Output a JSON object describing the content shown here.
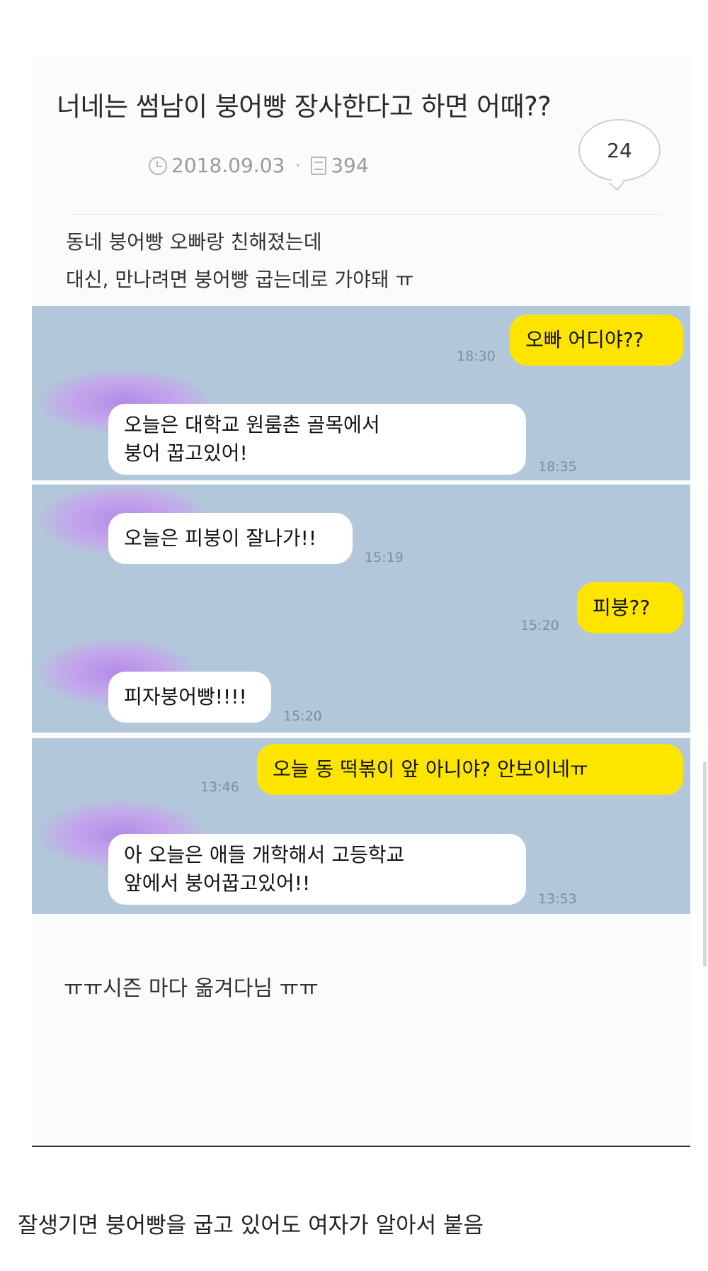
{
  "post": {
    "title": "너네는 썸남이 붕어빵 장사한다고 하면 어때??",
    "date": "2018.09.03",
    "views": "394",
    "comment_count": "24",
    "body_lines": [
      "동네 붕어빵 오빠랑 친해졌는데",
      "대신, 만나려면 붕어빵 굽는데로 가야돼 ㅠ"
    ],
    "footer": "ㅠㅠ시즌 마다 옮겨다님 ㅠㅠ"
  },
  "chats": [
    {
      "messages": [
        {
          "from": "me",
          "lines": [
            "오빠 어디야??"
          ],
          "time": "18:30"
        },
        {
          "from": "other",
          "lines": [
            "오늘은        대학교 원룸촌 골목에서",
            "붕어 꿉고있어!"
          ],
          "time": "18:35"
        }
      ]
    },
    {
      "messages": [
        {
          "from": "other",
          "lines": [
            "오늘은 피붕이 잘나가!!"
          ],
          "time": "15:19"
        },
        {
          "from": "me",
          "lines": [
            "피붕??"
          ],
          "time": "15:20"
        },
        {
          "from": "other",
          "lines": [
            "피자붕어빵!!!!"
          ],
          "time": "15:20"
        }
      ]
    },
    {
      "messages": [
        {
          "from": "me",
          "lines": [
            "오늘        동 떡볶이 앞 아니야? 안보이네ㅠ"
          ],
          "time": "13:46"
        },
        {
          "from": "other",
          "lines": [
            "아 오늘은 애들 개학해서        고등학교",
            "앞에서 붕어꿉고있어!!"
          ],
          "time": "13:53"
        }
      ]
    }
  ],
  "caption": "잘생기면 붕어빵을 굽고 있어도 여자가 알아서 붙음",
  "colors": {
    "chat_bg": "#b2c7da",
    "my_bubble": "#fee500",
    "their_bubble": "#ffffff",
    "avatar_blur": "#b38be6"
  },
  "icons": {
    "date": "clock-icon",
    "views": "document-icon"
  }
}
